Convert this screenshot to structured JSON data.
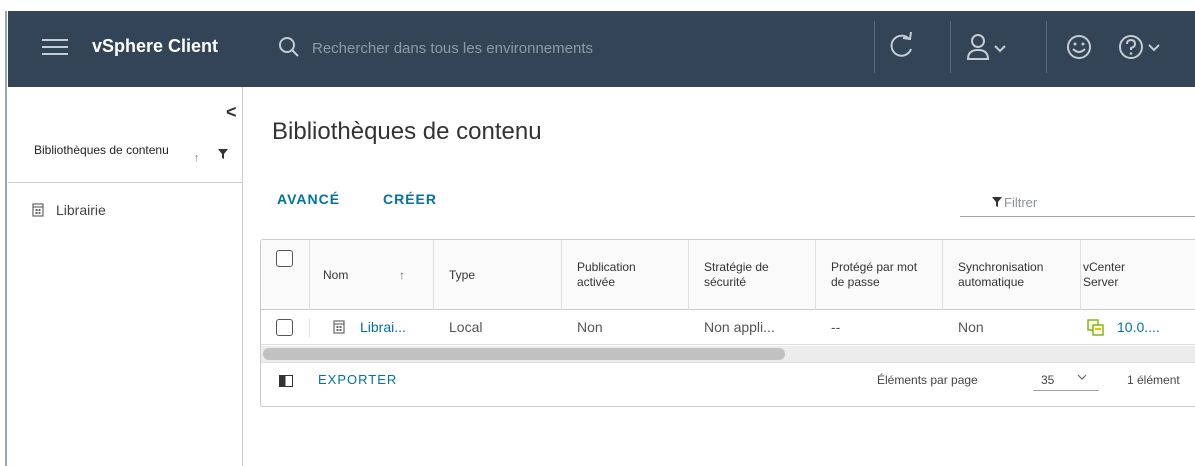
{
  "header": {
    "title": "vSphere Client",
    "search_placeholder": "Rechercher dans tous les environnements",
    "icons": [
      "menu-icon",
      "search-icon",
      "refresh-icon",
      "user-icon",
      "chevron-down-icon",
      "smiley-icon",
      "help-icon"
    ],
    "background": "#324456"
  },
  "sidebar": {
    "collapse_glyph": "<",
    "header_label": "Bibliothèques de contenu",
    "sort_glyph": "↑",
    "items": [
      {
        "label": "Librairie",
        "icon": "library-icon"
      }
    ]
  },
  "main": {
    "title": "Bibliothèques de contenu",
    "actions": {
      "advanced": "AVANCÉ",
      "create": "CRÉER"
    },
    "filter_placeholder": "Filtrer",
    "accent_color": "#0072a3",
    "table": {
      "columns": [
        "Nom",
        "Type",
        "Publication activée",
        "Stratégie de sécurité",
        "Protégé par mot de passe",
        "Synchronisation automatique",
        "vCenter Server"
      ],
      "sort_glyph": "↑",
      "rows": [
        {
          "name": "Librai...",
          "type": "Local",
          "publication": "Non",
          "security": "Non appli...",
          "password": "--",
          "sync": "Non",
          "vcenter": "10.0...."
        }
      ]
    },
    "footer": {
      "export": "EXPORTER",
      "per_page_label": "Éléments par page",
      "per_page_value": "35",
      "count": "1 élément"
    }
  }
}
